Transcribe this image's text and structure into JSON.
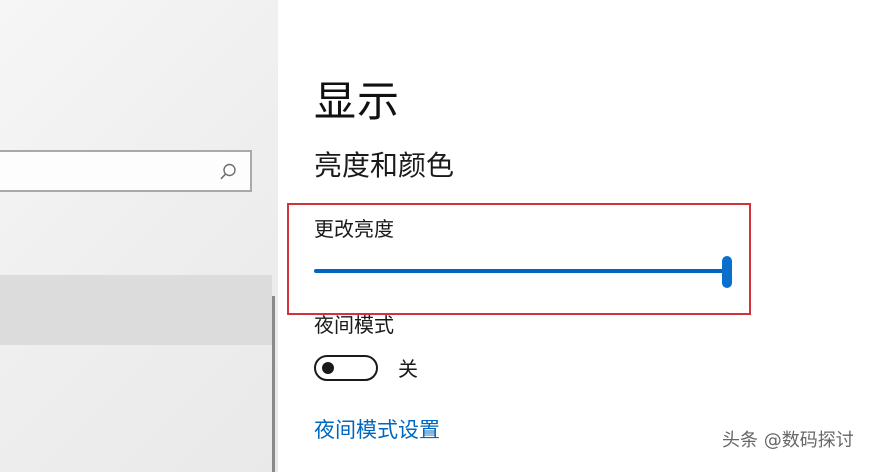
{
  "page": {
    "title": "显示"
  },
  "section": {
    "title": "亮度和颜色"
  },
  "brightness": {
    "label": "更改亮度",
    "value_percent": 100
  },
  "night_light": {
    "label": "夜间模式",
    "toggle_state_label": "关",
    "enabled": false,
    "settings_link": "夜间模式设置"
  },
  "sidebar": {
    "search_icon": "search-icon"
  },
  "watermark": {
    "text": "头条 @数码探讨"
  },
  "colors": {
    "accent": "#0067c0",
    "highlight_border": "#d13438"
  }
}
